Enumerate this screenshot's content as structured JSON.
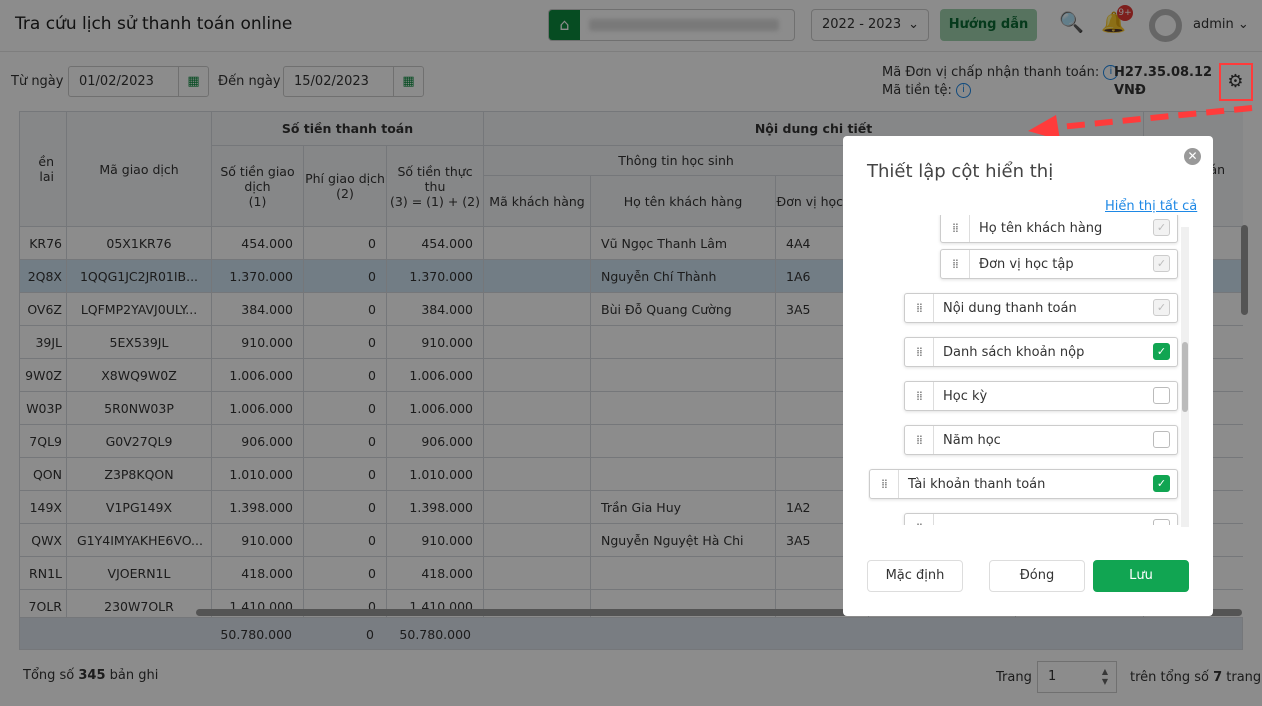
{
  "header": {
    "title": "Tra cứu lịch sử thanh toán online",
    "school_year": "2022 - 2023",
    "guide_label": "Hướng dẫn",
    "notification_badge": "9+",
    "username": "admin"
  },
  "filters": {
    "from_label": "Từ ngày",
    "from_value": "01/02/2023",
    "to_label": "Đến ngày",
    "to_value": "15/02/2023"
  },
  "merchant": {
    "code_label": "Mã Đơn vị chấp nhận thanh toán:",
    "code_value": "H27.35.08.12",
    "currency_label": "Mã tiền tệ:",
    "currency_value": "VNĐ"
  },
  "table": {
    "headers": {
      "col0": "ền lai",
      "txn_code": "Mã giao dịch",
      "amount_group": "Số tiền thanh toán",
      "amount": "Số tiền giao dịch\n(1)",
      "fee": "Phí giao dịch\n(2)",
      "net": "Số tiền thực thu\n(3) = (1) + (2)",
      "detail_group": "Nội dung chi tiết",
      "student_group": "Thông tin học sinh",
      "customer_code": "Mã khách hàng",
      "customer_name": "Họ tên khách hàng",
      "unit": "Đơn vị học tập",
      "last": "án"
    },
    "rows": [
      {
        "c0": "KR76",
        "code": "05X1KR76",
        "amount": "454.000",
        "fee": "0",
        "net": "454.000",
        "name": "Vũ Ngọc Thanh Lâm",
        "unit": "4A4"
      },
      {
        "c0": "2Q8X",
        "code": "1QQG1JC2JR01IB...",
        "amount": "1.370.000",
        "fee": "0",
        "net": "1.370.000",
        "name": "Nguyễn Chí Thành",
        "unit": "1A6",
        "selected": true
      },
      {
        "c0": "OV6Z",
        "code": "LQFMP2YAVJ0ULY...",
        "amount": "384.000",
        "fee": "0",
        "net": "384.000",
        "name": "Bùi Đỗ Quang Cường",
        "unit": "3A5"
      },
      {
        "c0": "39JL",
        "code": "5EX539JL",
        "amount": "910.000",
        "fee": "0",
        "net": "910.000",
        "name": "",
        "unit": ""
      },
      {
        "c0": "9W0Z",
        "code": "X8WQ9W0Z",
        "amount": "1.006.000",
        "fee": "0",
        "net": "1.006.000",
        "name": "",
        "unit": ""
      },
      {
        "c0": "W03P",
        "code": "5R0NW03P",
        "amount": "1.006.000",
        "fee": "0",
        "net": "1.006.000",
        "name": "",
        "unit": ""
      },
      {
        "c0": "7QL9",
        "code": "G0V27QL9",
        "amount": "906.000",
        "fee": "0",
        "net": "906.000",
        "name": "",
        "unit": ""
      },
      {
        "c0": "QON",
        "code": "Z3P8KQON",
        "amount": "1.010.000",
        "fee": "0",
        "net": "1.010.000",
        "name": "",
        "unit": ""
      },
      {
        "c0": "149X",
        "code": "V1PG149X",
        "amount": "1.398.000",
        "fee": "0",
        "net": "1.398.000",
        "name": "Trần Gia Huy",
        "unit": "1A2"
      },
      {
        "c0": "QWX",
        "code": "G1Y4IMYAKHE6VO...",
        "amount": "910.000",
        "fee": "0",
        "net": "910.000",
        "name": "Nguyễn Nguyệt Hà Chi",
        "unit": "3A5"
      },
      {
        "c0": "RN1L",
        "code": "VJOERN1L",
        "amount": "418.000",
        "fee": "0",
        "net": "418.000",
        "name": "",
        "unit": ""
      },
      {
        "c0": "7OLR",
        "code": "230W7OLR",
        "amount": "1.410.000",
        "fee": "0",
        "net": "1.410.000",
        "name": "",
        "unit": ""
      }
    ],
    "totals": {
      "amount": "50.780.000",
      "fee": "0",
      "net": "50.780.000"
    }
  },
  "footer": {
    "total_prefix": "Tổng số",
    "total_count": "345",
    "total_suffix": "bản ghi",
    "page_label": "Trang",
    "page_value": "1",
    "pages_prefix": "trên tổng số",
    "pages_count": "7",
    "pages_suffix": "trang"
  },
  "modal": {
    "title": "Thiết lập cột hiển thị",
    "show_all": "Hiển thị tất cả",
    "items": [
      {
        "label": "Họ tên khách hàng",
        "state": "disabled-checked"
      },
      {
        "label": "Đơn vị học tập",
        "state": "disabled-checked"
      },
      {
        "label": "Nội dung thanh toán",
        "state": "disabled-checked"
      },
      {
        "label": "Danh sách khoản nộp",
        "state": "checked"
      },
      {
        "label": "Học kỳ",
        "state": "unchecked"
      },
      {
        "label": "Năm học",
        "state": "unchecked"
      },
      {
        "label": "Tài khoản thanh toán",
        "state": "checked"
      },
      {
        "label": "",
        "state": "unchecked"
      }
    ],
    "default_label": "Mặc định",
    "close_label": "Đóng",
    "save_label": "Lưu"
  },
  "colors": {
    "brand_green": "#0b8a3e",
    "save_green": "#11a552",
    "annotation_red": "#ff3b3b",
    "link_blue": "#1e88e5"
  }
}
